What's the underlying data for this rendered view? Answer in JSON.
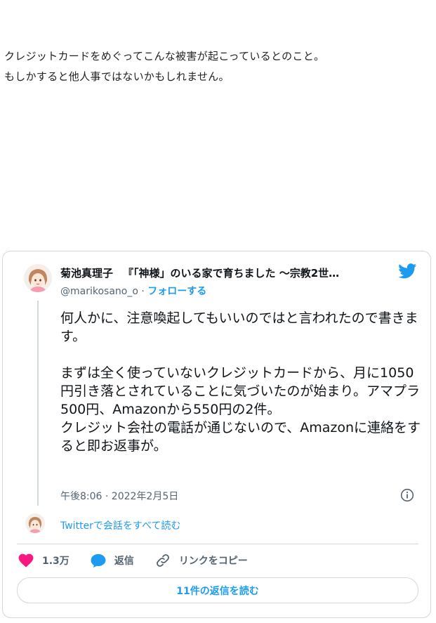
{
  "intro": {
    "line1": "クレジットカードをめぐってこんな被害が起こっているとのこと。",
    "line2": "もしかすると他人事ではないかもしれません。"
  },
  "tweet": {
    "author_name": "菊池真理子",
    "author_title": "『「神様」のいる家で育ちました ～宗教2世…",
    "handle": "@marikosano_o",
    "separator": "·",
    "follow_label": "フォローする",
    "body_p1": "何人かに、注意喚起してもいいのではと言われたので書きます。",
    "body_p2": "まずは全く使っていないクレジットカードから、月に1050円引き落とされていることに気づいたのが始まり。アマプラ500円、Amazonから550円の2件。",
    "body_p3": "クレジット会社の電話が通じないので、Amazonに連絡をすると即お返事が。",
    "timestamp": "午後8:06 · 2022年2月5日",
    "conversation_link": "Twitterで会話をすべて読む",
    "like_count": "1.3万",
    "reply_label": "返信",
    "copy_link_label": "リンクをコピー",
    "read_replies_label": "11件の返信を読む",
    "colors": {
      "accent": "#1d9bf0",
      "like": "#f91880",
      "muted": "#536471",
      "border": "#cfd9de"
    },
    "icons": [
      "twitter-bird-icon",
      "info-icon",
      "heart-icon",
      "reply-bubble-icon",
      "link-icon"
    ]
  }
}
